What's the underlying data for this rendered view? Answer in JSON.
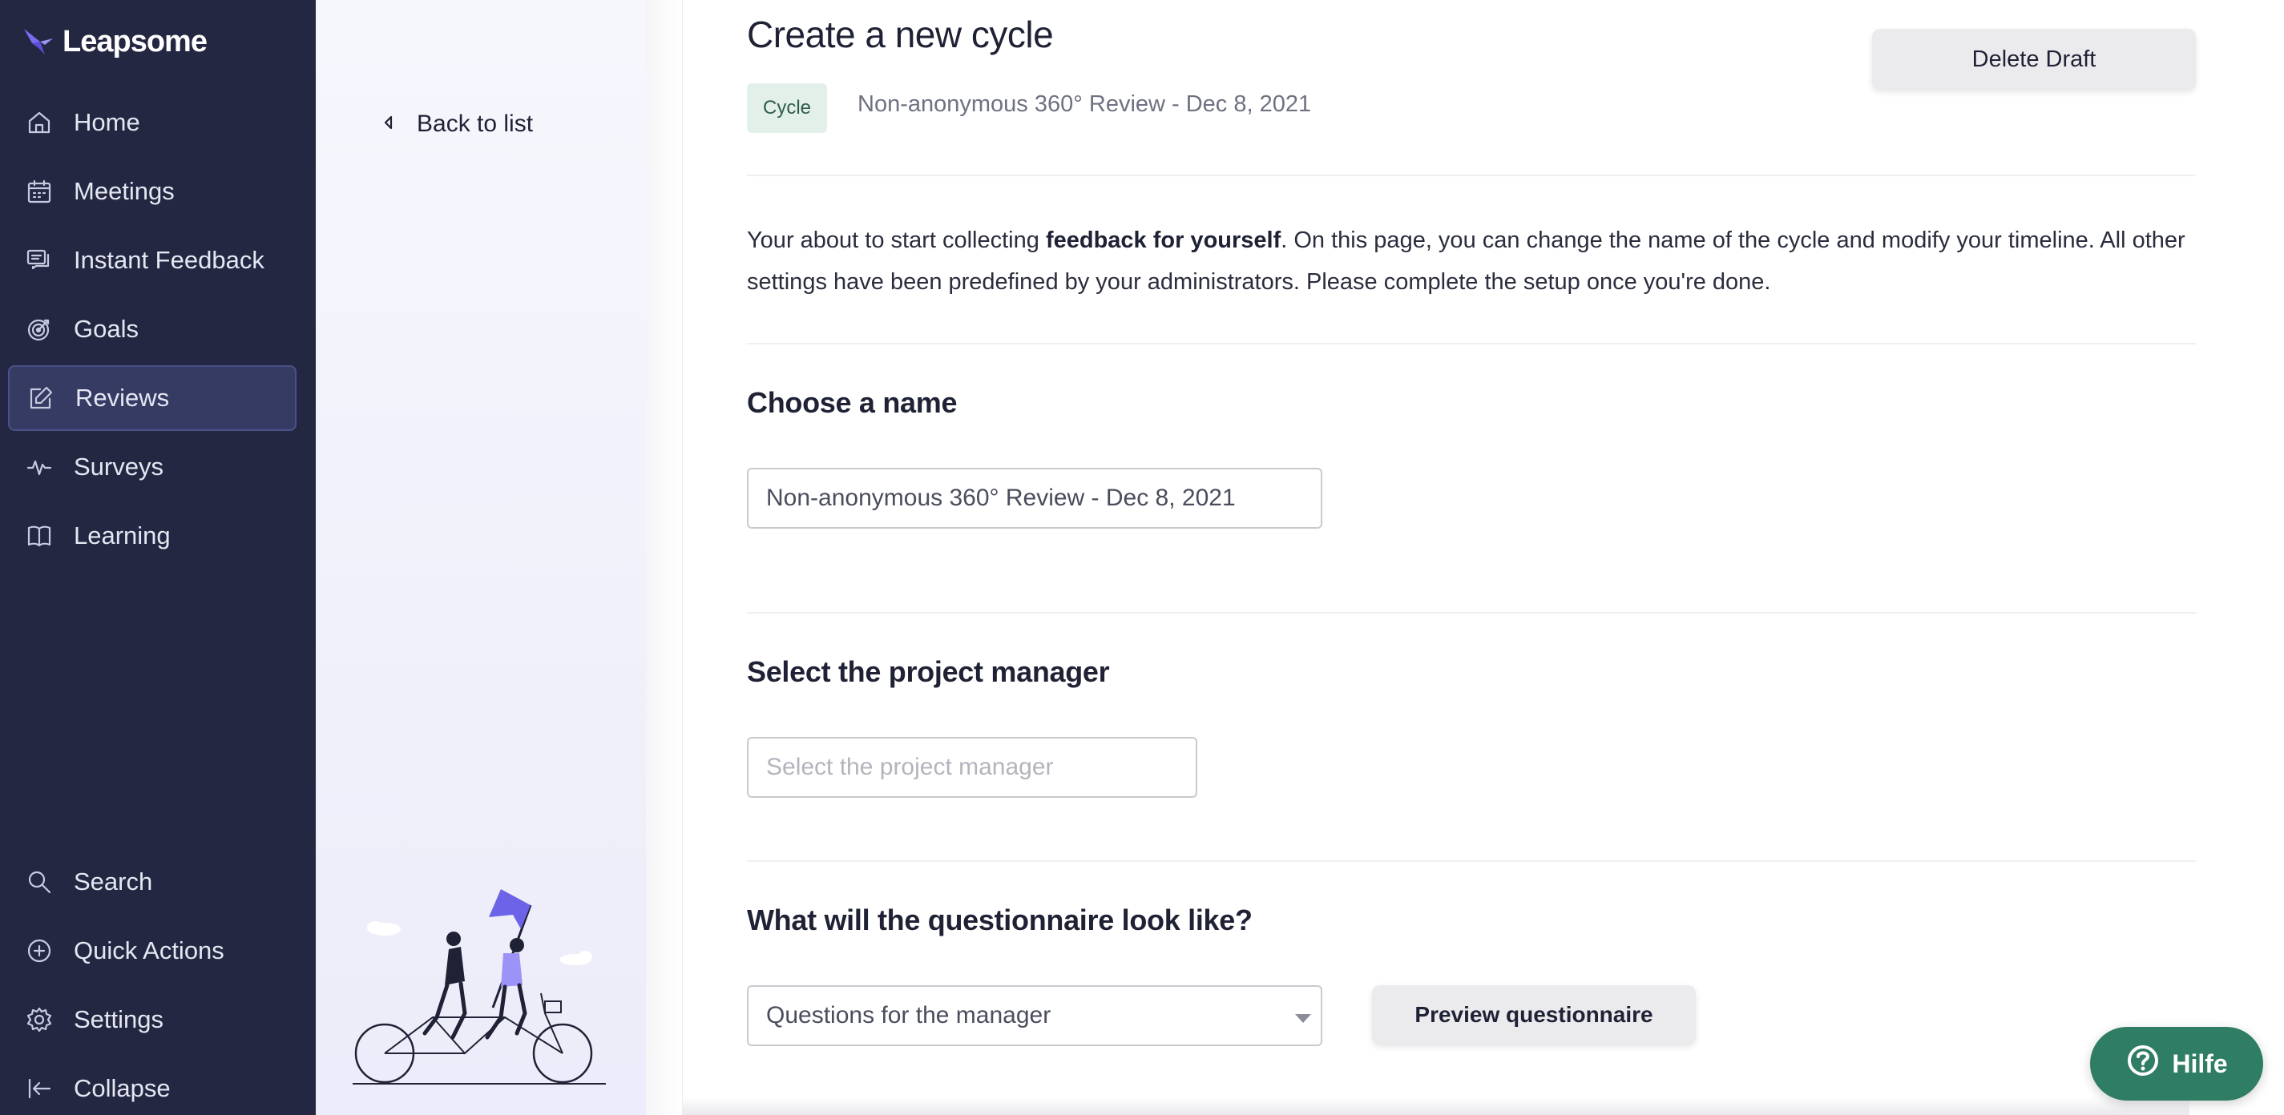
{
  "brand": {
    "name": "Leapsome",
    "accent": "#7b6cf2",
    "sidebar_bg": "#232742"
  },
  "sidebar": {
    "items": [
      {
        "label": "Home",
        "icon": "home-icon"
      },
      {
        "label": "Meetings",
        "icon": "calendar-icon"
      },
      {
        "label": "Instant Feedback",
        "icon": "chat-icon"
      },
      {
        "label": "Goals",
        "icon": "target-icon"
      },
      {
        "label": "Reviews",
        "icon": "edit-icon",
        "active": true
      },
      {
        "label": "Surveys",
        "icon": "pulse-icon"
      },
      {
        "label": "Learning",
        "icon": "book-icon"
      }
    ],
    "bottom_items": [
      {
        "label": "Search",
        "icon": "search-icon"
      },
      {
        "label": "Quick Actions",
        "icon": "plus-circle-icon"
      },
      {
        "label": "Settings",
        "icon": "gear-icon"
      },
      {
        "label": "Collapse",
        "icon": "collapse-icon"
      }
    ]
  },
  "subpanel": {
    "back_label": "Back to list"
  },
  "header": {
    "title": "Create a new cycle",
    "delete_label": "Delete Draft",
    "badge": "Cycle",
    "cycle_name": "Non-anonymous 360° Review - Dec 8, 2021"
  },
  "intro": {
    "text_before": "Your about to start collecting ",
    "text_bold": "feedback for yourself",
    "text_after": ". On this page, you can change the name of the cycle and modify your timeline. All other settings have been predefined by your administrators. Please complete the setup once you're done."
  },
  "name_section": {
    "title": "Choose a name",
    "value": "Non-anonymous 360° Review - Dec 8, 2021"
  },
  "manager_section": {
    "title": "Select the project manager",
    "placeholder": "Select the project manager"
  },
  "questionnaire_section": {
    "title": "What will the questionnaire look like?",
    "selected": "Questions for the manager",
    "preview_label": "Preview questionnaire"
  },
  "help": {
    "label": "Hilfe",
    "color": "#2e7d64"
  }
}
